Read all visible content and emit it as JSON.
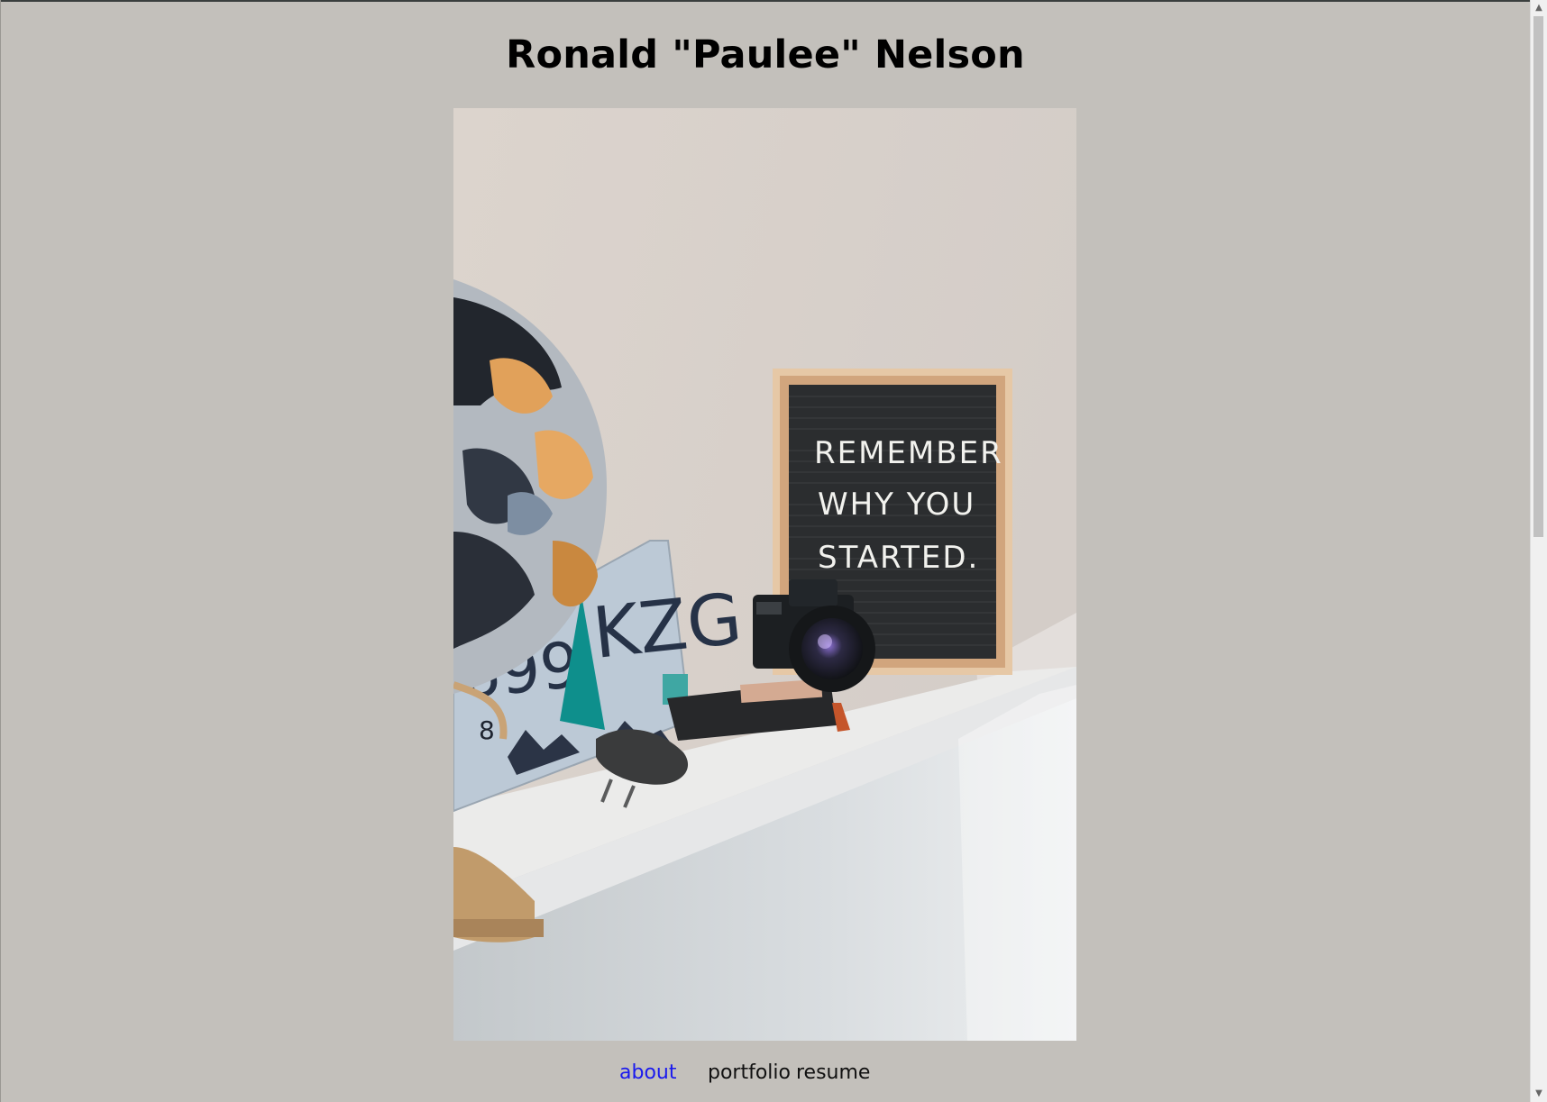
{
  "header": {
    "title": "Ronald \"Paulee\" Nelson"
  },
  "hero": {
    "letterboard_lines": [
      "REMEMBER",
      "WHY YOU",
      "STARTED."
    ],
    "plate_text": "KZG",
    "plate_partial": "699",
    "plate_small": "8"
  },
  "nav": {
    "items": [
      {
        "label": "about",
        "active": true
      },
      {
        "label": "portfolio",
        "active": false
      },
      {
        "label": "resume",
        "active": false
      }
    ]
  },
  "colors": {
    "page_bg": "#c3c0bb",
    "active_link": "#1a1aee",
    "link": "#111111"
  }
}
